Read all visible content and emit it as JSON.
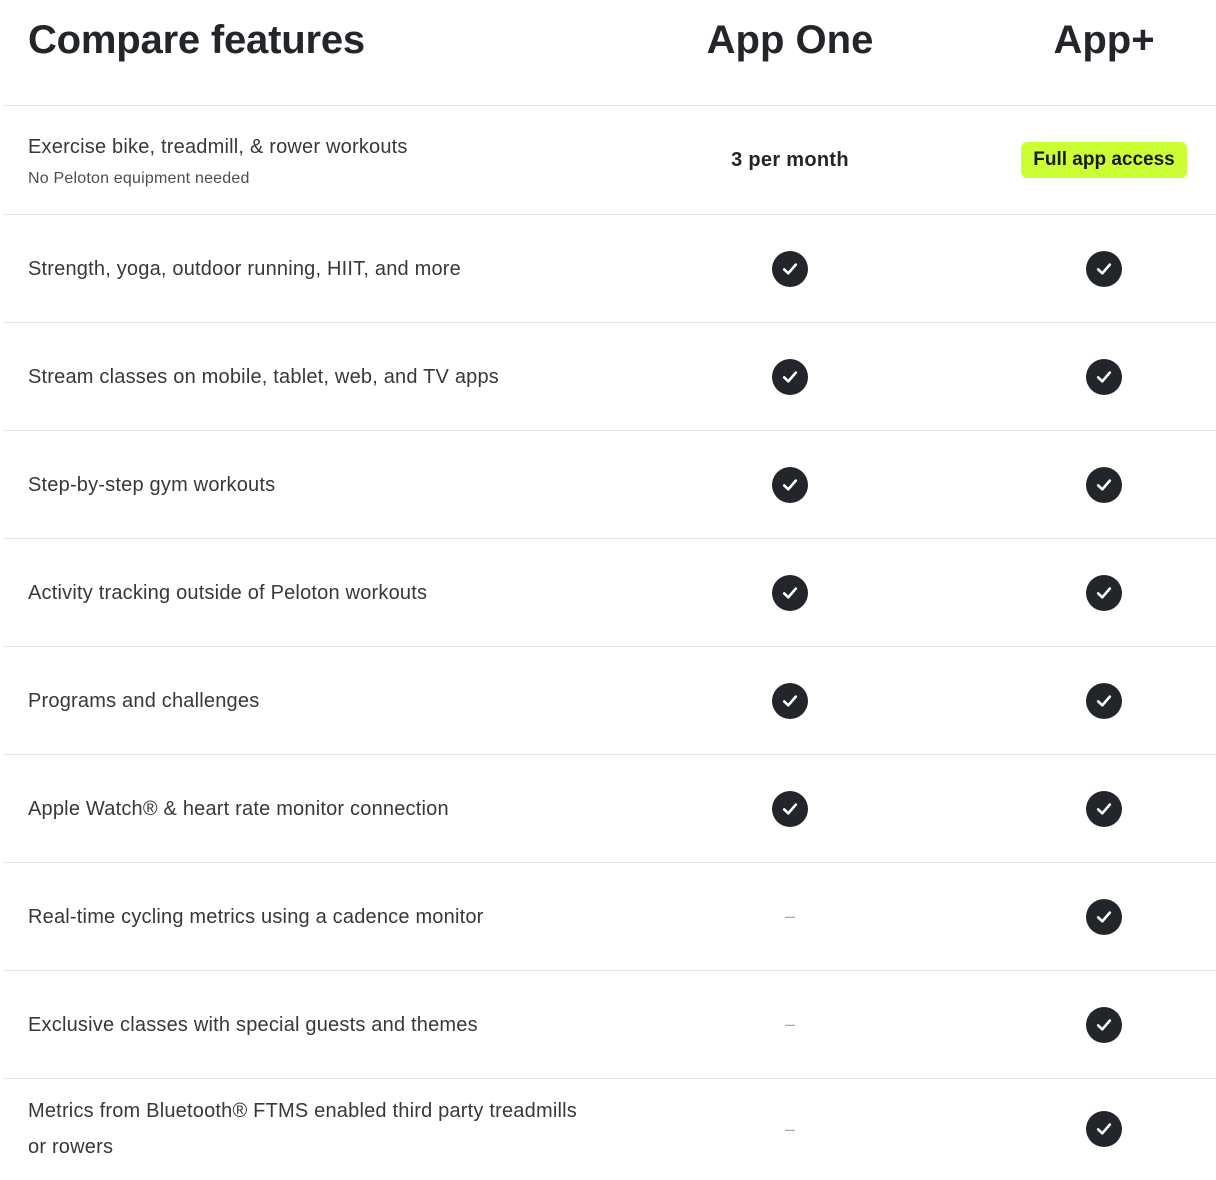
{
  "header": {
    "title": "Compare features",
    "plans": [
      "App One",
      "App+"
    ]
  },
  "rows": [
    {
      "label": "Exercise bike, treadmill, & rower workouts",
      "sublabel": "No Peloton equipment needed",
      "app_one": "3 per month",
      "app_plus": "Full app access"
    },
    {
      "label": "Strength, yoga, outdoor running, HIIT, and more",
      "app_one": "check",
      "app_plus": "check"
    },
    {
      "label": "Stream classes on mobile, tablet, web, and TV apps",
      "app_one": "check",
      "app_plus": "check"
    },
    {
      "label": "Step-by-step gym workouts",
      "app_one": "check",
      "app_plus": "check"
    },
    {
      "label": "Activity tracking outside of Peloton workouts",
      "app_one": "check",
      "app_plus": "check"
    },
    {
      "label": "Programs and challenges",
      "app_one": "check",
      "app_plus": "check"
    },
    {
      "label": "Apple Watch® & heart rate monitor connection",
      "app_one": "check",
      "app_plus": "check"
    },
    {
      "label": "Real-time cycling metrics using a cadence monitor",
      "app_one": "–",
      "app_plus": "check"
    },
    {
      "label": "Exclusive classes with special guests and themes",
      "app_one": "–",
      "app_plus": "check"
    },
    {
      "label": "Metrics from Bluetooth® FTMS enabled third party treadmills or rowers",
      "app_one": "–",
      "app_plus": "check"
    }
  ],
  "colors": {
    "badge_background": "#ccff33",
    "check_background": "#222529",
    "divider": "#e2e3e5"
  },
  "icons": {
    "included": "check-circle-icon"
  }
}
